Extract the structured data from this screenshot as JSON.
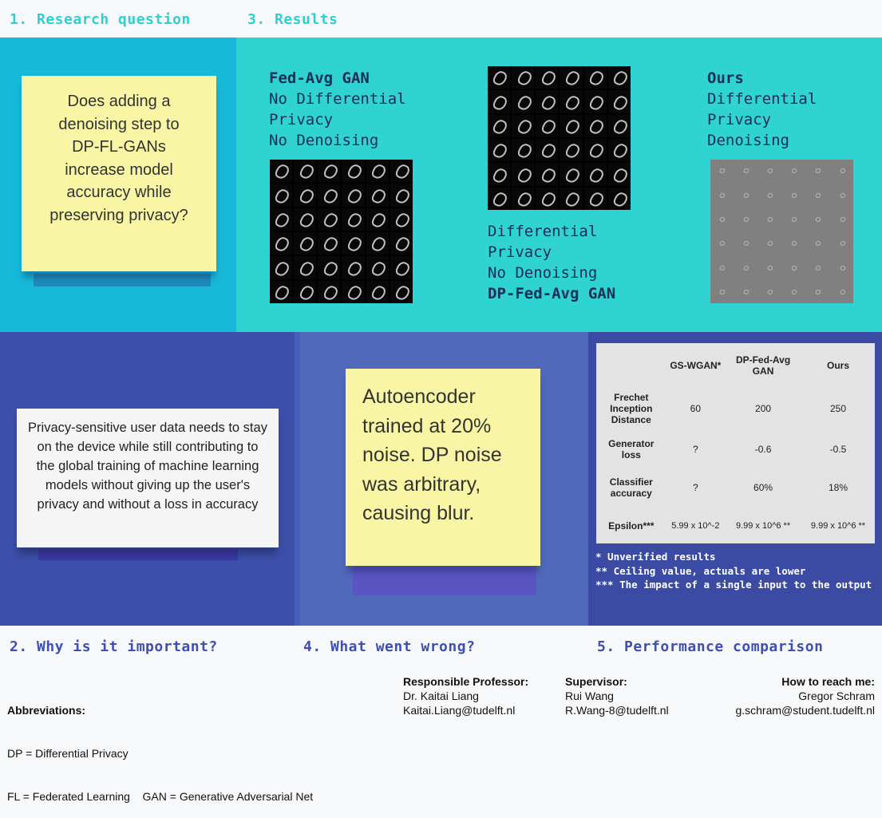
{
  "headers": {
    "h1": "1. Research question",
    "h3": "3. Results",
    "h2": "2. Why is it important?",
    "h4": "4. What went wrong?",
    "h5": "5. Performance comparison"
  },
  "research_question": "Does adding a denoising step to DP-FL-GANs increase model accuracy while preserving privacy?",
  "results": {
    "fedavg": {
      "title": "Fed-Avg GAN",
      "line1": "No Differential",
      "line2": "Privacy",
      "line3": "No Denoising"
    },
    "dpfedavg": {
      "line1": "Differential",
      "line2": "Privacy",
      "line3": "No Denoising",
      "title": "DP-Fed-Avg GAN"
    },
    "ours": {
      "title": "Ours",
      "line1": "Differential",
      "line2": "Privacy",
      "line3": "Denoising"
    }
  },
  "importance": "Privacy-sensitive user data needs to stay on the device while still contributing to the global training of machine learning models without giving up the user's privacy and without a loss in accuracy",
  "wrong": "Autoencoder trained at 20% noise. DP noise was arbitrary, causing blur.",
  "comparison": {
    "columns": [
      "",
      "GS-WGAN*",
      "DP-Fed-Avg GAN",
      "Ours"
    ],
    "rows": [
      {
        "label": "Frechet Inception Distance",
        "values": [
          "60",
          "200",
          "250"
        ]
      },
      {
        "label": "Generator loss",
        "values": [
          "?",
          "-0.6",
          "-0.5"
        ]
      },
      {
        "label": "Classifier accuracy",
        "values": [
          "?",
          "60%",
          "18%"
        ]
      },
      {
        "label": "Epsilon***",
        "values": [
          "5.99 x 10^-2",
          "9.99 x 10^6 **",
          "9.99 x 10^6 **"
        ]
      }
    ],
    "notes": [
      "* Unverified results",
      "** Ceiling value, actuals are lower",
      "*** The impact of a single input to the output"
    ]
  },
  "footer": {
    "abbr_title": "Abbreviations:",
    "abbr1": "DP = Differential Privacy",
    "abbr2": "FL = Federated Learning    GAN = Generative Adversarial Net",
    "prof_title": "Responsible Professor:",
    "prof_name": "Dr. Kaitai Liang",
    "prof_email": "Kaitai.Liang@tudelft.nl",
    "sup_title": "Supervisor:",
    "sup_name": "Rui Wang",
    "sup_email": "R.Wang-8@tudelft.nl",
    "contact_title": "How to reach me:",
    "contact_name": "Gregor Schram",
    "contact_email": "g.schram@student.tudelft.nl"
  },
  "colors": {
    "research_bg": "#17b9d9",
    "results_bg": "#2ed3d2",
    "why_bg": "#3d4fa8",
    "wrong_bg": "#5169bb",
    "perf_bg": "#3b4aa3"
  }
}
